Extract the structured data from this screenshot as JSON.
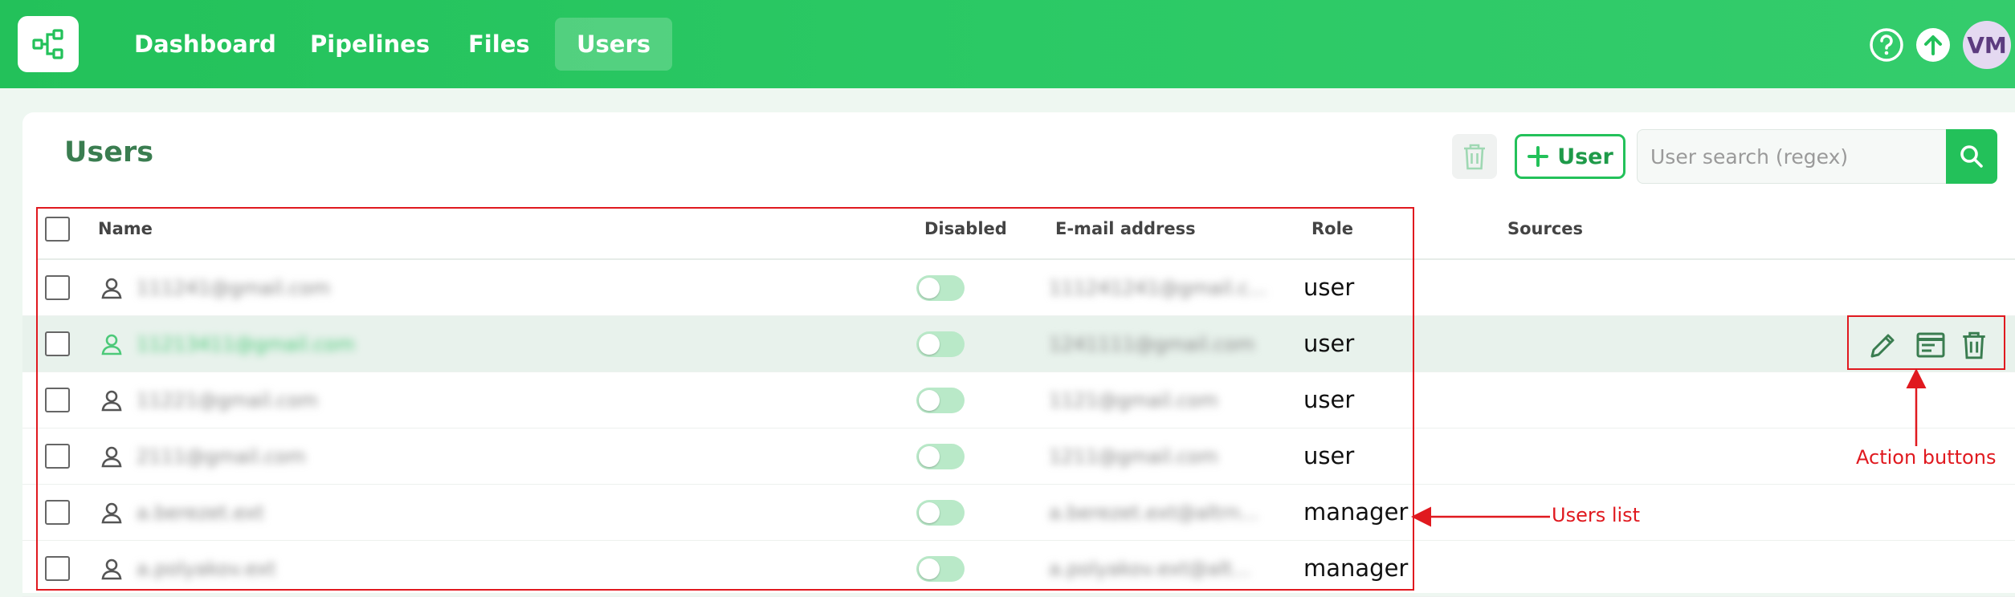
{
  "nav": {
    "items": [
      {
        "label": "Dashboard",
        "active": false
      },
      {
        "label": "Pipelines",
        "active": false
      },
      {
        "label": "Files",
        "active": false
      },
      {
        "label": "Users",
        "active": true
      }
    ],
    "avatar_initials": "VM",
    "icons": [
      "logo-pipeline-icon",
      "help-icon",
      "upload-icon"
    ]
  },
  "page": {
    "title": "Users",
    "add_user_label": "User",
    "search_placeholder": "User search (regex)"
  },
  "table": {
    "columns": [
      "Name",
      "Disabled",
      "E-mail address",
      "Role",
      "Sources"
    ],
    "rows": [
      {
        "name": "111241@gmail.com",
        "email": "111241241@gmail.c...",
        "role": "user",
        "disabled": false
      },
      {
        "name": "11213411@gmail.com",
        "email": "1241111@gmail.com",
        "role": "user",
        "disabled": false
      },
      {
        "name": "11221@gmail.com",
        "email": "1121@gmail.com",
        "role": "user",
        "disabled": false
      },
      {
        "name": "2111@gmail.com",
        "email": "1211@gmail.com",
        "role": "user",
        "disabled": false
      },
      {
        "name": "a.berezet.ext",
        "email": "a.berezet.ext@altrn...",
        "role": "manager",
        "disabled": false
      },
      {
        "name": "a.polyakov.ext",
        "email": "a.polyakov.ext@alt...",
        "role": "manager",
        "disabled": false
      }
    ]
  },
  "annotations": {
    "users_list": "Users list",
    "action_buttons": "Action buttons"
  },
  "colors": {
    "brand": "#23c15a",
    "title_green": "#3a7d50",
    "annotation_red": "#e0191f"
  }
}
